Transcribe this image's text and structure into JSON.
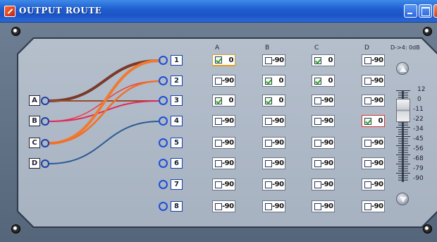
{
  "window": {
    "title": "OUTPUT ROUTE"
  },
  "inputs": [
    "A",
    "B",
    "C",
    "D"
  ],
  "outputs": [
    "1",
    "2",
    "3",
    "4",
    "5",
    "6",
    "7",
    "8"
  ],
  "matrix": {
    "columns": [
      "A",
      "B",
      "C",
      "D"
    ],
    "gain_header": "D->4: 0dB",
    "rows": [
      [
        {
          "checked": true,
          "value": "0",
          "highlight": true
        },
        {
          "checked": false,
          "value": "-90"
        },
        {
          "checked": true,
          "value": "0"
        },
        {
          "checked": false,
          "value": "-90"
        }
      ],
      [
        {
          "checked": false,
          "value": "-90"
        },
        {
          "checked": true,
          "value": "0"
        },
        {
          "checked": true,
          "value": "0"
        },
        {
          "checked": false,
          "value": "-90"
        }
      ],
      [
        {
          "checked": true,
          "value": "0"
        },
        {
          "checked": true,
          "value": "0"
        },
        {
          "checked": false,
          "value": "-90"
        },
        {
          "checked": false,
          "value": "-90"
        }
      ],
      [
        {
          "checked": false,
          "value": "-90"
        },
        {
          "checked": false,
          "value": "-90"
        },
        {
          "checked": false,
          "value": "-90"
        },
        {
          "checked": true,
          "value": "0",
          "selected": true
        }
      ],
      [
        {
          "checked": false,
          "value": "-90"
        },
        {
          "checked": false,
          "value": "-90"
        },
        {
          "checked": false,
          "value": "-90"
        },
        {
          "checked": false,
          "value": "-90"
        }
      ],
      [
        {
          "checked": false,
          "value": "-90"
        },
        {
          "checked": false,
          "value": "-90"
        },
        {
          "checked": false,
          "value": "-90"
        },
        {
          "checked": false,
          "value": "-90"
        }
      ],
      [
        {
          "checked": false,
          "value": "-90"
        },
        {
          "checked": false,
          "value": "-90"
        },
        {
          "checked": false,
          "value": "-90"
        },
        {
          "checked": false,
          "value": "-90"
        }
      ],
      [
        {
          "checked": false,
          "value": "-90"
        },
        {
          "checked": false,
          "value": "-90"
        },
        {
          "checked": false,
          "value": "-90"
        },
        {
          "checked": false,
          "value": "-90"
        }
      ]
    ]
  },
  "fader": {
    "scale": [
      "12",
      "0",
      "-11",
      "-22",
      "-34",
      "-45",
      "-56",
      "-68",
      "-79",
      "-90"
    ],
    "level_db": 0
  },
  "routes": [
    {
      "from": "A",
      "to": "1",
      "color": "#7a3a28",
      "width": 4
    },
    {
      "from": "A",
      "to": "3",
      "color": "#9a4a30",
      "width": 2
    },
    {
      "from": "B",
      "to": "2",
      "color": "#e84040",
      "width": 1.5
    },
    {
      "from": "B",
      "to": "3",
      "color": "#e02a5a",
      "width": 2
    },
    {
      "from": "C",
      "to": "1",
      "color": "#f07a30",
      "width": 4
    },
    {
      "from": "C",
      "to": "2",
      "color": "#f0702a",
      "width": 2.5
    },
    {
      "from": "D",
      "to": "4",
      "color": "#2a5a90",
      "width": 2
    }
  ],
  "colors": {
    "titlebar": "#1f5fd0",
    "panel": "#b0bac8",
    "check": "#2ea32e"
  }
}
